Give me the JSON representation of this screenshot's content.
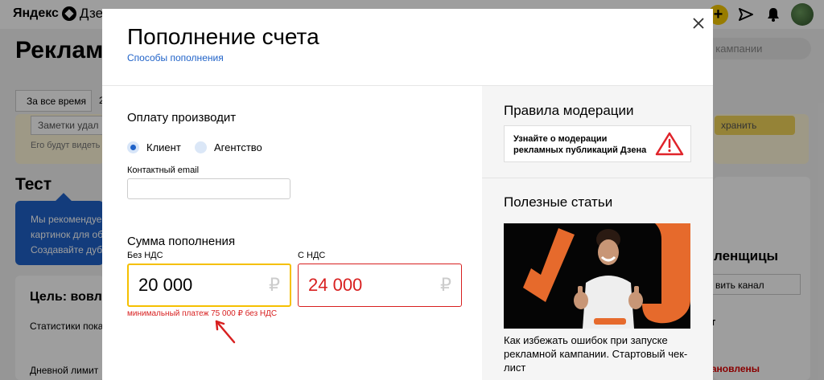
{
  "topbar": {
    "logo_primary": "Яндекс",
    "logo_secondary": "Дзен",
    "plus_icon": "plus-icon",
    "send_icon": "paper-plane-icon",
    "bell_icon": "bell-icon"
  },
  "background": {
    "title": "Реклам",
    "search_placeholder": "к кампании",
    "period_tab": "За все время",
    "period_tab_2": "2",
    "notes_field": "Заметки удал",
    "notes_sub": "Его будут видеть",
    "save_btn": "хранить",
    "section_title": "Тест",
    "tip_text": [
      "Мы рекомендуем",
      "картинок для обл",
      "Создавайте дубл"
    ],
    "goal": "Цель: вовле",
    "stats": "Статистики пока",
    "daily_limit": "Дневной лимит",
    "audience": "ленщицы",
    "add_channel": "вить канал",
    "right_t": "т",
    "installed": "тановлены"
  },
  "modal": {
    "title": "Пополнение счета",
    "link": "Способы пополнения",
    "payer_label": "Оплату производит",
    "payer_options": [
      "Клиент",
      "Агентство"
    ],
    "payer_selected": "Клиент",
    "email_label": "Контактный email",
    "email_value": "",
    "amount_label": "Сумма пополнения",
    "net_label": "Без НДС",
    "net_value": "20 000",
    "vat_label": "С НДС",
    "vat_value": "24 000",
    "currency": "₽",
    "min_note": "минимальный платеж 75 000 ₽ без НДС",
    "moderation_title": "Правила модерации",
    "moderation_card": [
      "Узнайте о модерации",
      "рекламных публикаций Дзена"
    ],
    "articles_title": "Полезные статьи",
    "article_text": "Как избежать ошибок при запуске рекламной кампании. Стартовый чек-лист"
  },
  "colors": {
    "accent_blue": "#1f62c8",
    "error_red": "#d82020",
    "focus_yellow": "#f5c000",
    "brand_orange": "#e66a2c"
  }
}
